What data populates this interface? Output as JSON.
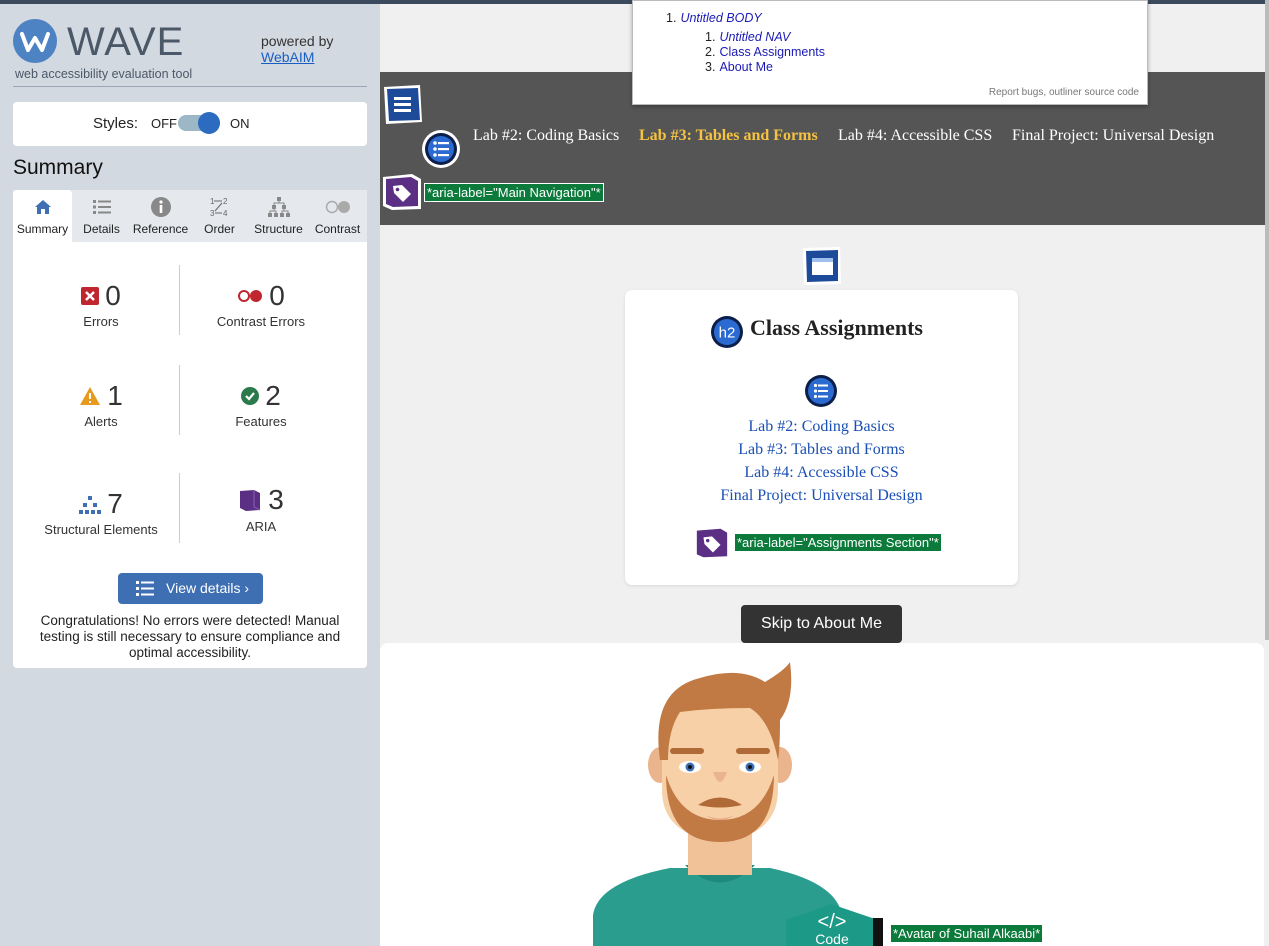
{
  "wave": {
    "brand": "WAVE",
    "subtitle": "web accessibility evaluation tool",
    "powered_by": "powered by",
    "webaim": "WebAIM",
    "styles_label": "Styles:",
    "styles_off": "OFF",
    "styles_on": "ON",
    "summary_title": "Summary",
    "tabs": [
      {
        "label": "Summary",
        "icon": "home-icon",
        "active": true
      },
      {
        "label": "Details",
        "icon": "list-icon"
      },
      {
        "label": "Reference",
        "icon": "info-icon"
      },
      {
        "label": "Order",
        "icon": "order-icon"
      },
      {
        "label": "Structure",
        "icon": "structure-icon"
      },
      {
        "label": "Contrast",
        "icon": "contrast-icon"
      }
    ],
    "stats": {
      "errors": {
        "value": "0",
        "label": "Errors"
      },
      "contrast_errors": {
        "value": "0",
        "label": "Contrast Errors"
      },
      "alerts": {
        "value": "1",
        "label": "Alerts"
      },
      "features": {
        "value": "2",
        "label": "Features"
      },
      "structural": {
        "value": "7",
        "label": "Structural Elements"
      },
      "aria": {
        "value": "3",
        "label": "ARIA"
      }
    },
    "view_details": "View details ›",
    "congrats": "Congratulations! No errors were detected! Manual testing is still necessary to ensure compliance and optimal accessibility."
  },
  "outline": {
    "items": [
      {
        "num": "1.",
        "label": "Untitled BODY"
      }
    ],
    "sub_items": [
      {
        "num": "1.",
        "label": "Untitled NAV",
        "italic": true
      },
      {
        "num": "2.",
        "label": "Class Assignments"
      },
      {
        "num": "3.",
        "label": "About Me"
      }
    ],
    "report_bugs": "Report bugs",
    "separator": ",",
    "source": "outliner source code"
  },
  "nav": {
    "links": [
      {
        "label": "Lab #2: Coding Basics"
      },
      {
        "label": "Lab #3: Tables and Forms",
        "active": true
      },
      {
        "label": "Lab #4: Accessible CSS"
      },
      {
        "label": "Final Project: Universal Design"
      }
    ],
    "aria_label": "*aria-label=\"Main Navigation\"*"
  },
  "assignments": {
    "heading_badge": "h2",
    "title": "Class Assignments",
    "links": [
      "Lab #2: Coding Basics",
      "Lab #3: Tables and Forms",
      "Lab #4: Accessible CSS",
      "Final Project: Universal Design"
    ],
    "aria_label": "*aria-label=\"Assignments Section\"*"
  },
  "skip_button": "Skip to About Me",
  "about": {
    "code_badge_symbol": "</>",
    "code_badge_label": "Code",
    "avatar_alt": "*Avatar of Suhail Alkaabi*"
  },
  "colors": {
    "nav_bg": "#555555",
    "nav_active": "#f5c242",
    "link_blue": "#1a4fb3",
    "aria_green": "#0b7a3a",
    "wave_blue": "#3f6fb3"
  }
}
